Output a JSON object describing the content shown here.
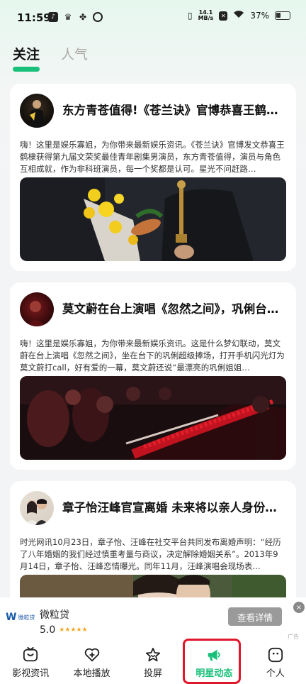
{
  "status_bar": {
    "time": "11:59",
    "net_speed_value": "14.1",
    "net_speed_unit": "MB/s",
    "battery": "37%"
  },
  "tabs": [
    {
      "label": "关注",
      "active": true
    },
    {
      "label": "人气",
      "active": false
    }
  ],
  "cards": [
    {
      "title": "东方青苍值得!《苍兰诀》官博恭喜王鹤…",
      "body": "嗨！这里是娱乐寡姐，为你带来最新娱乐资讯。《苍兰诀》官博发文恭喜王鹤棣获得第九届文荣奖最佳青年剧集男演员，东方青苍值得，演员与角色互相成就，作为非科班演员，每一个奖都是认可。星光不问赶路…"
    },
    {
      "title": "莫文蔚在台上演唱《忽然之间》，巩俐台…",
      "body": "嗨！这里是娱乐寡姐，为你带来最新娱乐资讯。这是什么梦幻联动，莫文蔚在台上演唱《忽然之间》，坐在台下的巩俐超级捧场，打开手机闪光灯为莫文蔚打call，好有爱的一幕，莫文蔚还说“最漂亮的巩俐姐姐…"
    },
    {
      "title": "章子怡汪峰官宣离婚 未来将以亲人身份…",
      "body": "时光网讯10月23日，章子怡、汪峰在社交平台共同发布离婚声明：“经历了八年婚姻的我们经过慎重考量与商议，决定解除婚姻关系”。2013年9月14日，章子怡、汪峰恋情曝光。同年11月，汪峰演唱会现场表…"
    }
  ],
  "ad": {
    "logo_text": "微粒贷",
    "name": "微粒贷",
    "score": "5.0",
    "stars": "★★★★★",
    "button": "查看详情",
    "close": "×",
    "tag": "广告"
  },
  "bottom_nav": [
    {
      "label": "影视资讯",
      "icon": "tv-icon",
      "active": false
    },
    {
      "label": "本地播放",
      "icon": "heart-plus-icon",
      "active": false
    },
    {
      "label": "投屏",
      "icon": "star-face-icon",
      "active": false
    },
    {
      "label": "明星动态",
      "icon": "megaphone-icon",
      "active": true
    },
    {
      "label": "个人",
      "icon": "smile-icon",
      "active": false
    }
  ],
  "colors": {
    "accent": "#19c07a",
    "highlight": "#e0162b"
  }
}
